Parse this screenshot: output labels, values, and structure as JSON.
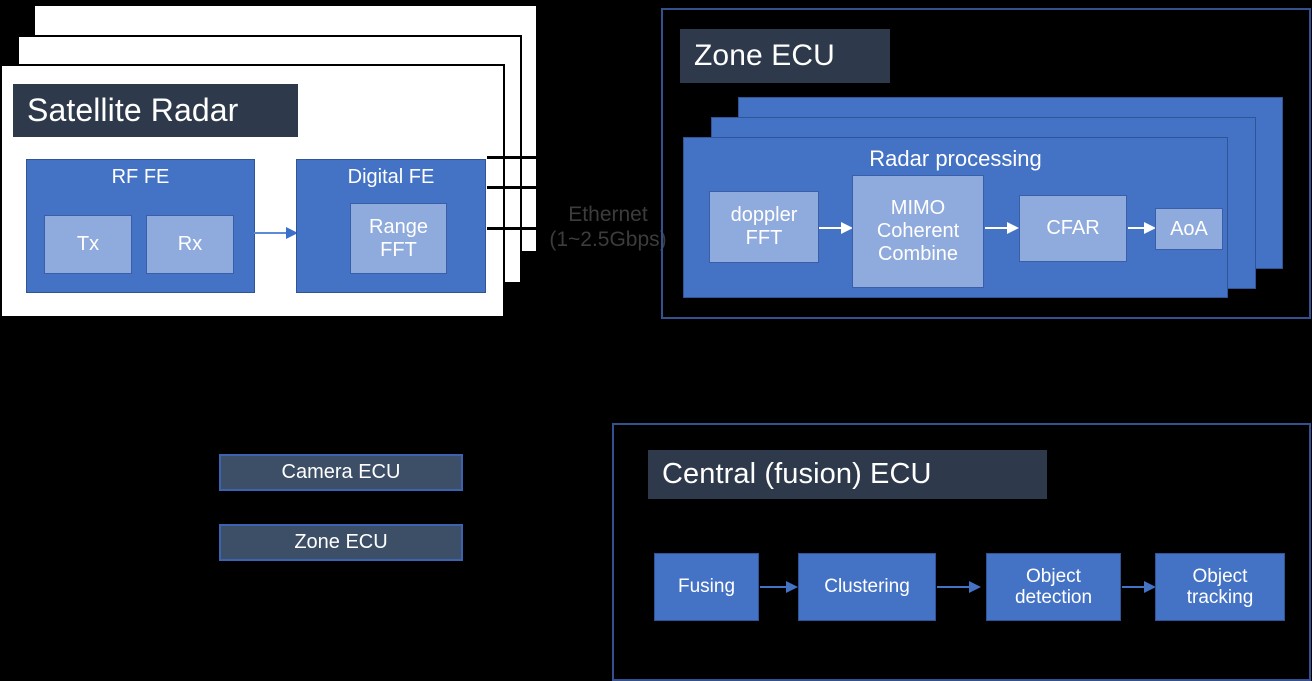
{
  "satellite_radar": {
    "title": "Satellite Radar",
    "rf_fe": {
      "label": "RF FE",
      "tx": "Tx",
      "rx": "Rx"
    },
    "digital_fe": {
      "label": "Digital FE",
      "range_fft": "Range\nFFT"
    }
  },
  "link": {
    "line1": "Ethernet",
    "line2": "(1~2.5Gbps)"
  },
  "zone_ecu": {
    "title": "Zone ECU",
    "radar_processing": {
      "caption": "Radar processing",
      "blocks": [
        "doppler\nFFT",
        "MIMO\nCoherent\nCombine",
        "CFAR",
        "AoA"
      ]
    }
  },
  "legend": {
    "items": [
      "Camera ECU",
      "Zone ECU"
    ]
  },
  "central_ecu": {
    "title": "Central (fusion) ECU",
    "pipeline": [
      "Fusing",
      "Clustering",
      "Object\ndetection",
      "Object\ntracking"
    ]
  },
  "colors": {
    "background": "#000000",
    "card": "#ffffff",
    "title_plate": "#2E3A4B",
    "blue_block": "#4472C4",
    "light_blue_block": "#8FAADC",
    "frame_border": "#33508F",
    "legend_chip": "#3D4F66",
    "legend_chip_border": "#3C63B0",
    "ethernet_text": "#3C3C3C"
  }
}
